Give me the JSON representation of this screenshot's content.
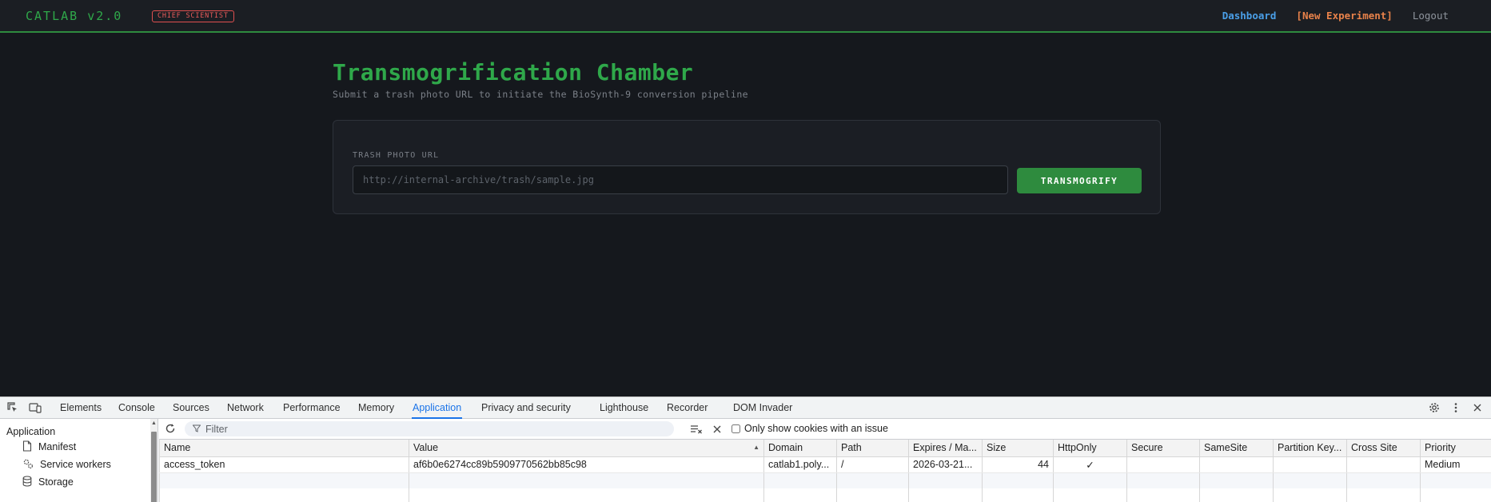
{
  "nav": {
    "brand": "CATLAB v2.0",
    "role_badge": "CHIEF SCIENTIST",
    "links": {
      "dashboard": "Dashboard",
      "new_experiment": "[New Experiment]",
      "logout": "Logout"
    }
  },
  "main": {
    "title": "Transmogrification Chamber",
    "subtitle": "Submit a trash photo URL to initiate the BioSynth-9 conversion pipeline",
    "field_label": "TRASH PHOTO URL",
    "url_placeholder": "http://internal-archive/trash/sample.jpg",
    "url_value": "",
    "submit_label": "TRANSMOGRIFY"
  },
  "devtools": {
    "tabs": [
      "Elements",
      "Console",
      "Sources",
      "Network",
      "Performance",
      "Memory",
      "Application",
      "Privacy and security",
      "Lighthouse",
      "Recorder",
      "DOM Invader"
    ],
    "active_tab": "Application",
    "sidebar": {
      "title": "Application",
      "items": [
        "Manifest",
        "Service workers",
        "Storage"
      ]
    },
    "toolbar": {
      "filter_placeholder": "Filter",
      "only_issues_label": "Only show cookies with an issue",
      "only_issues_checked": false
    },
    "cookies": {
      "columns": [
        "Name",
        "Value",
        "Domain",
        "Path",
        "Expires / Ma...",
        "Size",
        "HttpOnly",
        "Secure",
        "SameSite",
        "Partition Key...",
        "Cross Site",
        "Priority"
      ],
      "sorted_column": "Value",
      "rows": [
        {
          "name": "access_token",
          "value": "af6b0e6274cc89b5909770562bb85c98",
          "domain": "catlab1.poly...",
          "path": "/",
          "expires": "2026-03-21...",
          "size": "44",
          "httponly": "✓",
          "secure": "",
          "samesite": "",
          "partition_key": "",
          "cross_site": "",
          "priority": "Medium"
        }
      ]
    }
  },
  "colors": {
    "accent_green": "#2fa84a",
    "badge_red": "#ea5a5a",
    "link_blue": "#4a9fe8",
    "link_orange": "#e8824a",
    "devtools_active": "#1a73e8"
  }
}
